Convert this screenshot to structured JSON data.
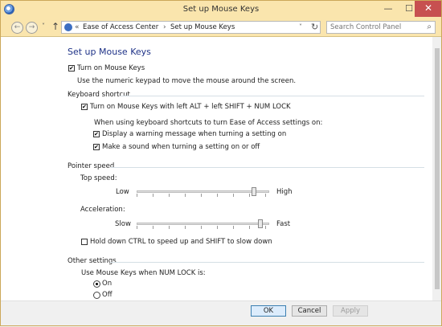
{
  "window": {
    "title": "Set up Mouse Keys",
    "minimize": "—",
    "maximize": "☐",
    "close": "✕"
  },
  "nav": {
    "back": "←",
    "forward": "→",
    "recent": "˅",
    "up": "↑",
    "breadcrumb_sep": "«",
    "crumbs": [
      "Ease of Access Center",
      "Set up Mouse Keys"
    ],
    "crumb_arrow": "›",
    "dropdown": "˅",
    "refresh": "↻",
    "search_placeholder": "Search Control Panel",
    "search_icon": "⌕"
  },
  "page": {
    "title": "Set up Mouse Keys",
    "turn_on_label": "Turn on Mouse Keys",
    "turn_on_checked": true,
    "turn_on_desc": "Use the numeric keypad to move the mouse around the screen."
  },
  "keyboard_shortcut": {
    "section_label": "Keyboard shortcut",
    "shortcut_label": "Turn on Mouse Keys with left ALT + left SHIFT + NUM LOCK",
    "shortcut_checked": true,
    "when_label": "When using keyboard shortcuts to turn Ease of Access settings on:",
    "warning_label": "Display a warning message when turning a setting on",
    "warning_checked": true,
    "sound_label": "Make a sound when turning a setting on or off",
    "sound_checked": true
  },
  "pointer_speed": {
    "section_label": "Pointer speed",
    "top_speed_label": "Top speed:",
    "top_low": "Low",
    "top_high": "High",
    "top_value": 0.9,
    "accel_label": "Acceleration:",
    "accel_low": "Slow",
    "accel_high": "Fast",
    "accel_value": 0.95,
    "ctrl_label": "Hold down CTRL to speed up and SHIFT to slow down",
    "ctrl_checked": false
  },
  "other_settings": {
    "section_label": "Other settings",
    "numlock_label": "Use Mouse Keys when NUM LOCK is:",
    "on_label": "On",
    "off_label": "Off",
    "selected": "On"
  },
  "footer": {
    "ok": "OK",
    "cancel": "Cancel",
    "apply": "Apply"
  },
  "colors": {
    "title_bar": "#fae5ad",
    "page_title": "#1e3287",
    "close_button": "#c75050"
  }
}
